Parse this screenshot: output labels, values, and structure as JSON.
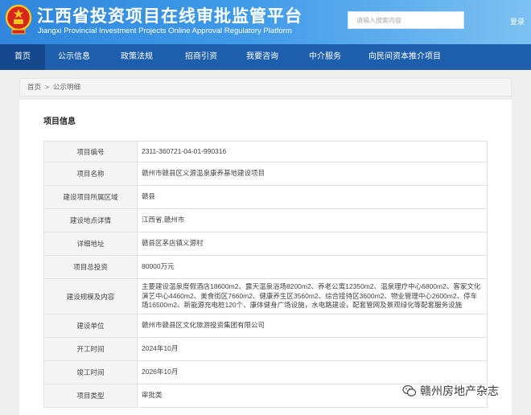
{
  "header": {
    "title": "江西省投资项目在线审批监管平台",
    "subtitle": "Jiangxi Provincial Investment Projects Online Approval Regulatory Platform",
    "search_placeholder": "请输入搜索内容",
    "login_label": "登录",
    "emblem_icon": "national-emblem-icon",
    "colors": {
      "header_start": "#2f86dc",
      "header_end": "#7cc1f2",
      "nav": "#1d5fac"
    }
  },
  "nav": {
    "items": [
      {
        "label": "首页"
      },
      {
        "label": "公示信息"
      },
      {
        "label": "政策法规"
      },
      {
        "label": "招商引资"
      },
      {
        "label": "我要咨询"
      },
      {
        "label": "中介服务"
      },
      {
        "label": "向民间资本推介项目"
      }
    ]
  },
  "breadcrumb": {
    "home": "首页",
    "separator": ">",
    "current": "公示明细"
  },
  "section": {
    "title": "项目信息"
  },
  "project": {
    "rows": [
      {
        "label": "项目编号",
        "value": "2311-360721-04-01-990316"
      },
      {
        "label": "项目名称",
        "value": "赣州市赣县区义源温泉康养基地建设项目"
      },
      {
        "label": "建设项目所属区域",
        "value": "赣县"
      },
      {
        "label": "建设地点详情",
        "value": "江西省,赣州市"
      },
      {
        "label": "详细地址",
        "value": "赣县区茅店镇义源村"
      },
      {
        "label": "项目总投资",
        "value": "80000万元"
      },
      {
        "label": "建设规模及内容",
        "value": "主要建设温泉度假酒店18600m2、露天温泉浴场8200m2、养老公寓12350m2、温泉理疗中心6800m2、客家文化演艺中心4460m2、美食街区7660m2、健康养生区3560m2、综合接待区3600m2、物业管理中心2600m2、停车场16500m2、新能源充电桩120个、康体健身广场设施，水电路建设，配套管网及景观绿化等配套服务设施"
      },
      {
        "label": "建设单位",
        "value": "赣州市赣县区文化旅游投资集团有限公司"
      },
      {
        "label": "开工时间",
        "value": "2024年10月"
      },
      {
        "label": "竣工时间",
        "value": "2026年10月"
      },
      {
        "label": "项目类型",
        "value": "审批类"
      }
    ]
  },
  "watermark": {
    "text": "赣州房地产杂志",
    "icon": "wechat-icon"
  }
}
